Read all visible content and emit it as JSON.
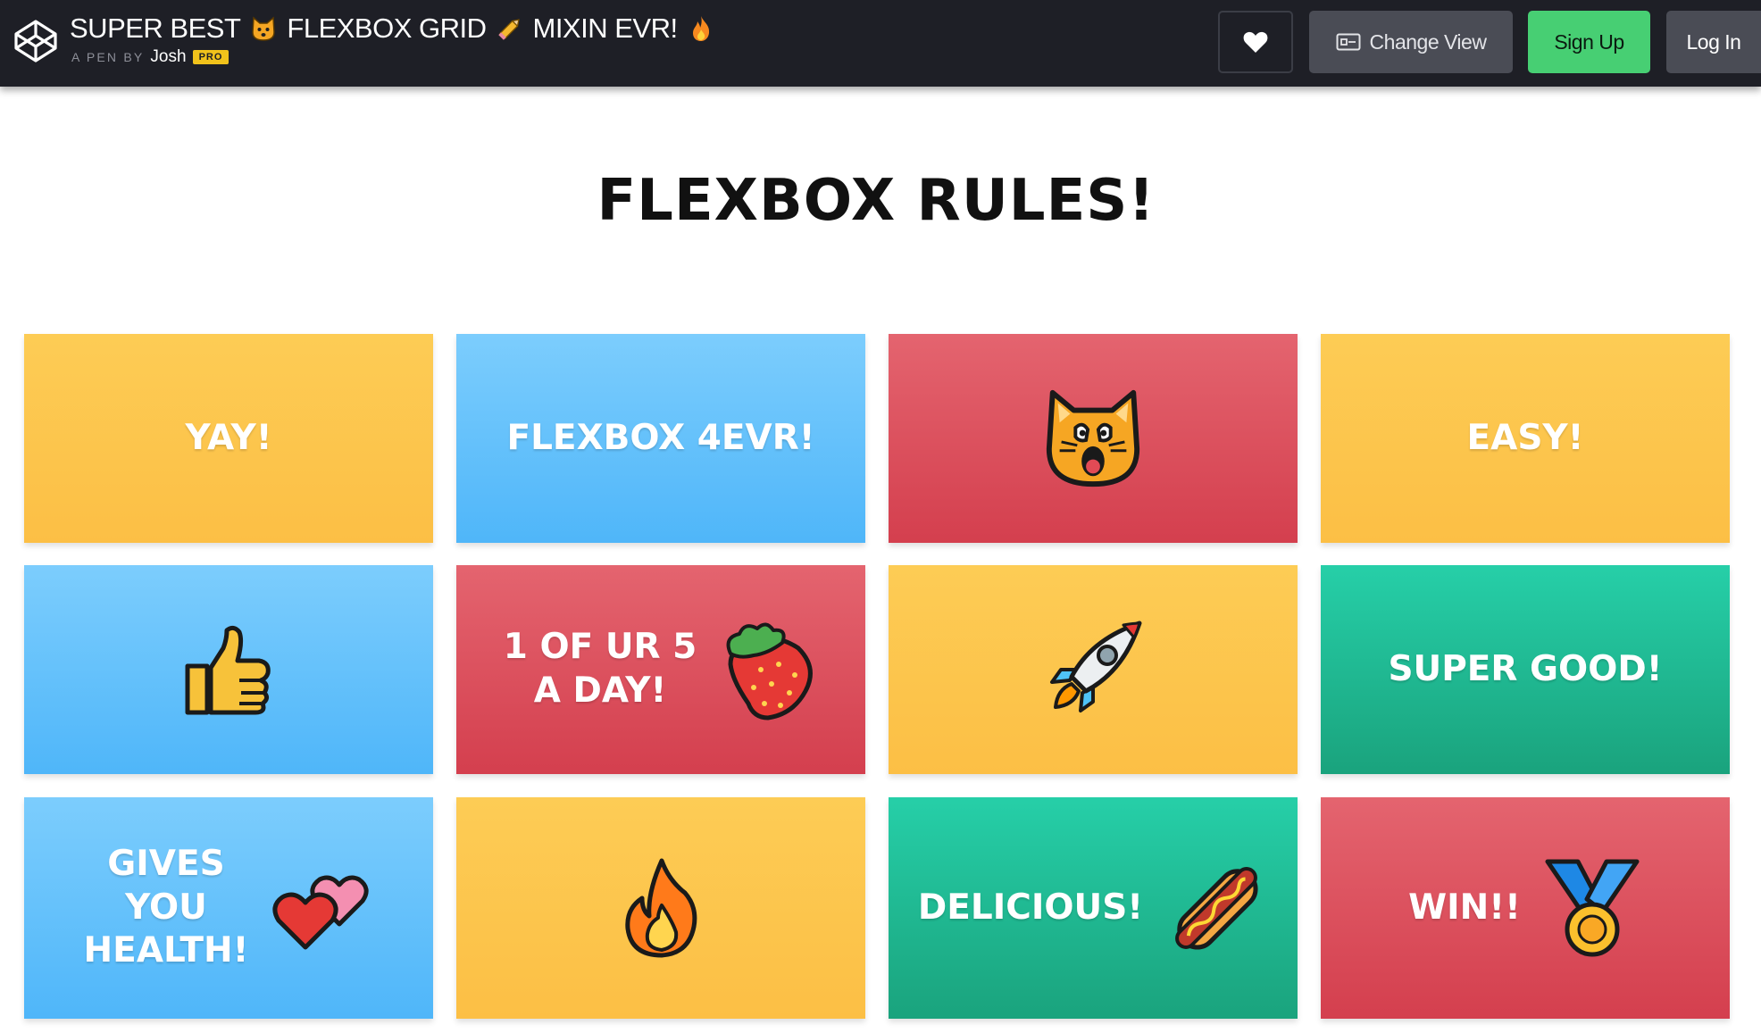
{
  "header": {
    "title_parts": [
      "SUPER BEST",
      "FLEXBOX GRID",
      "MIXIN EVR!"
    ],
    "title_icons": [
      "cat-face-icon",
      "pencil-icon",
      "fire-icon"
    ],
    "pen_by": "A PEN BY",
    "author": "Josh",
    "pro_badge": "PRO",
    "heart_icon": "heart-icon",
    "change_view_label": "Change View",
    "sign_up_label": "Sign Up",
    "log_in_label": "Log In",
    "colors": {
      "bar": "#1e1f26",
      "sign_up": "#47cf73",
      "button": "#4a4c55",
      "pro": "#f1c21b"
    }
  },
  "main": {
    "title": "FLEXBOX RULES!",
    "tiles": [
      {
        "label": "YAY!",
        "icon": "",
        "color": "yellow"
      },
      {
        "label": "FLEXBOX 4EVR!",
        "icon": "",
        "color": "blue"
      },
      {
        "label": "",
        "icon": "screaming-cat-icon",
        "color": "red"
      },
      {
        "label": "EASY!",
        "icon": "",
        "color": "yellow"
      },
      {
        "label": "",
        "icon": "thumbs-up-icon",
        "color": "blue"
      },
      {
        "label": "1 OF UR 5\nA DAY!",
        "icon": "strawberry-icon",
        "color": "red"
      },
      {
        "label": "",
        "icon": "rocket-icon",
        "color": "yellow"
      },
      {
        "label": "SUPER GOOD!",
        "icon": "",
        "color": "green"
      },
      {
        "label": "GIVES\nYOU\nHEALTH!",
        "icon": "two-hearts-icon",
        "color": "blue"
      },
      {
        "label": "",
        "icon": "fire-icon",
        "color": "yellow"
      },
      {
        "label": "DELICIOUS!",
        "icon": "hot-dog-icon",
        "color": "green"
      },
      {
        "label": "WIN!!",
        "icon": "medal-icon",
        "color": "red"
      }
    ],
    "colors": {
      "yellow": "#fdc64e",
      "blue": "#65c1fb",
      "red": "#dc505d",
      "green": "#20b993"
    }
  }
}
